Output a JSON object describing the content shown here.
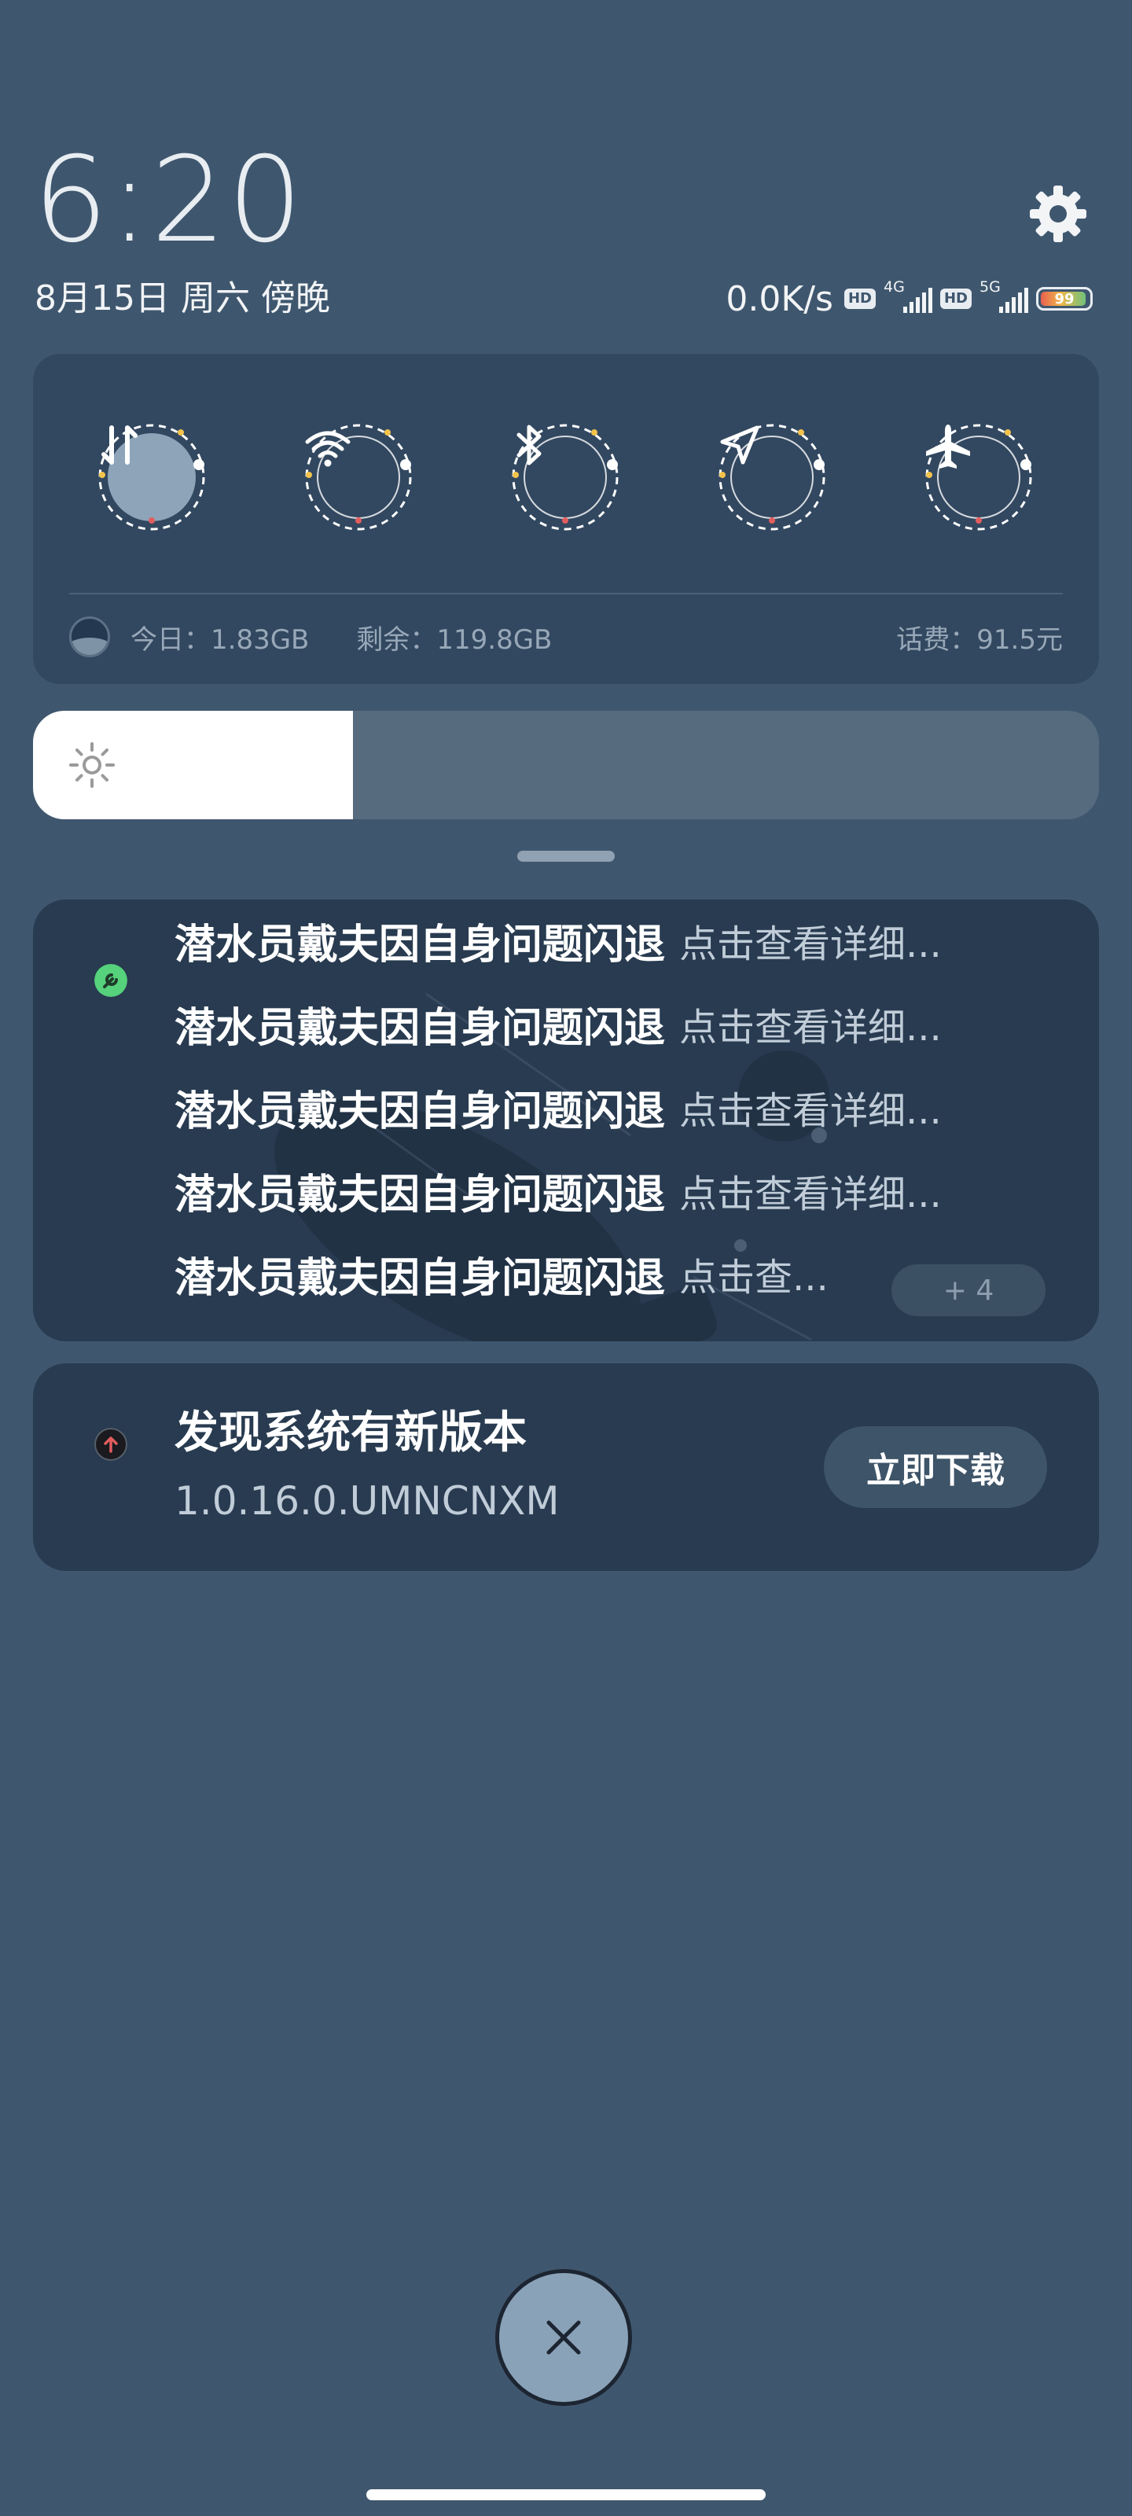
{
  "header": {
    "time": "6:20",
    "date": "8月15日 周六 傍晚",
    "network_speed": "0.0K/s",
    "sim1": {
      "hd": "HD",
      "type": "4G"
    },
    "sim2": {
      "hd": "HD",
      "type": "5G"
    },
    "battery": "99",
    "settings_icon": "gear-icon"
  },
  "quick_settings": {
    "toggles": [
      {
        "name": "mobile-data",
        "icon": "mobile-data-icon",
        "active": true
      },
      {
        "name": "wifi",
        "icon": "wifi-icon",
        "active": false
      },
      {
        "name": "bluetooth",
        "icon": "bluetooth-icon",
        "active": false
      },
      {
        "name": "location",
        "icon": "location-icon",
        "active": false
      },
      {
        "name": "airplane-mode",
        "icon": "airplane-icon",
        "active": false
      }
    ],
    "usage_today": "今日：1.83GB",
    "remaining": "剩余：119.8GB",
    "phone_bill": "话费：91.5元"
  },
  "brightness": {
    "level": 0.3,
    "icon": "sun-icon"
  },
  "notifications": {
    "group": {
      "app_icon": "wrench-icon",
      "items": [
        {
          "title": "潜水员戴夫因自身问题闪退",
          "body": "点击查看详细..."
        },
        {
          "title": "潜水员戴夫因自身问题闪退",
          "body": "点击查看详细..."
        },
        {
          "title": "潜水员戴夫因自身问题闪退",
          "body": "点击查看详细..."
        },
        {
          "title": "潜水员戴夫因自身问题闪退",
          "body": "点击查看详细..."
        },
        {
          "title": "潜水员戴夫因自身问题闪退",
          "body": "点击查..."
        }
      ],
      "more_count": "+ 4"
    },
    "update": {
      "app_icon": "upload-icon",
      "title": "发现系统有新版本",
      "version": "1.0.16.0.UMNCNXM",
      "action": "立即下载"
    }
  },
  "clear_button_icon": "close-icon",
  "colors": {
    "background": "#3f576e",
    "card": "#283b50",
    "qs_card": "#324860",
    "accent_green": "#55d27b"
  }
}
